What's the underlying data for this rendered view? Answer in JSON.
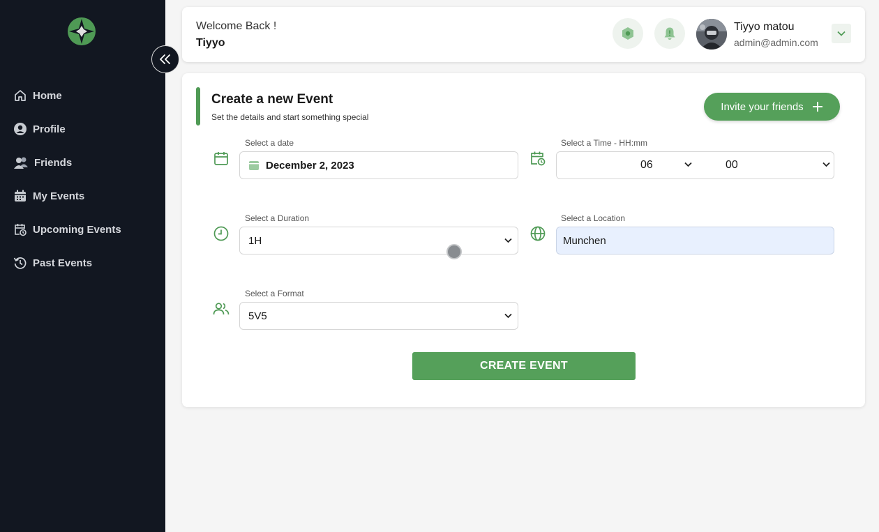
{
  "sidebar": {
    "items": [
      {
        "label": "Home",
        "icon": "home-icon"
      },
      {
        "label": "Profile",
        "icon": "user-circle-icon"
      },
      {
        "label": "Friends",
        "icon": "users-icon"
      },
      {
        "label": "My Events",
        "icon": "calendar-icon"
      },
      {
        "label": "Upcoming Events",
        "icon": "calendar-clock-icon"
      },
      {
        "label": "Past Events",
        "icon": "history-icon"
      }
    ]
  },
  "header": {
    "welcome": "Welcome Back !",
    "username": "Tiyyo",
    "profile_name": "Tiyyo matou",
    "profile_email": "admin@admin.com"
  },
  "form": {
    "title": "Create a new Event",
    "subtitle": "Set the details and start something special",
    "invite_label": "Invite your friends",
    "date_label": "Select a date",
    "date_value": "December 2, 2023",
    "time_label": "Select a Time - HH:mm",
    "hour_value": "06",
    "minute_value": "00",
    "duration_label": "Select a Duration",
    "duration_value": "1H",
    "location_label": "Select a Location",
    "location_value": "Munchen",
    "format_label": "Select a Format",
    "format_value": "5V5",
    "submit_label": "CREATE EVENT"
  },
  "colors": {
    "accent": "#55a05a",
    "sidebar_bg": "#121721",
    "location_field_bg": "#e8f0fe"
  }
}
